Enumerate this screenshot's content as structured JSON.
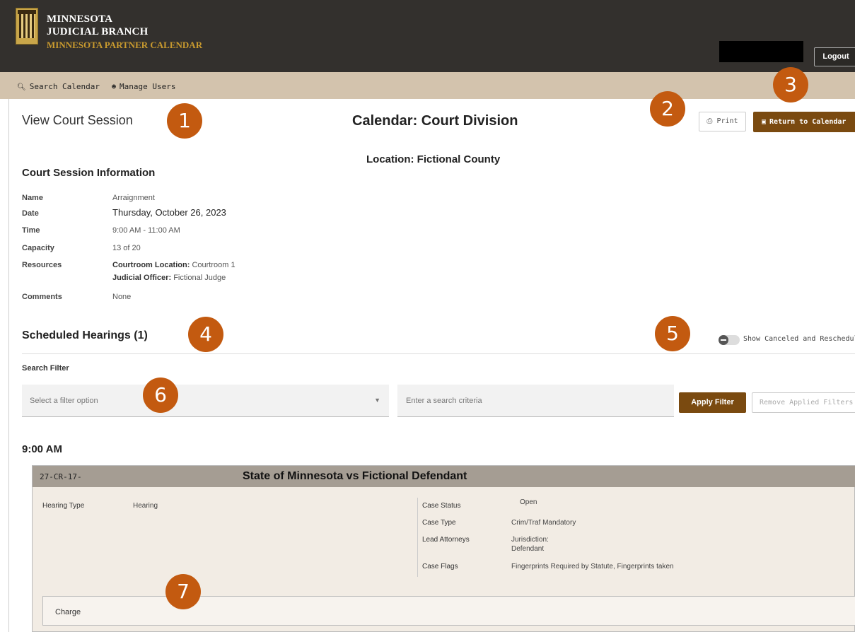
{
  "header": {
    "brand_line1": "MINNESOTA",
    "brand_line2": "JUDICIAL BRANCH",
    "brand_line3": "MINNESOTA PARTNER CALENDAR",
    "logout_label": "Logout"
  },
  "nav": {
    "search_calendar": "Search Calendar",
    "manage_users": "Manage Users"
  },
  "page": {
    "title": "View Court Session",
    "calendar_title": "Calendar: Court Division",
    "location_title": "Location: Fictional County",
    "print_label": "Print",
    "return_label": "Return to Calendar"
  },
  "session_info": {
    "heading": "Court Session Information",
    "name_label": "Name",
    "name_value": "Arraignment",
    "date_label": "Date",
    "date_value": "Thursday, October 26, 2023",
    "time_label": "Time",
    "time_value": "9:00 AM - 11:00 AM",
    "capacity_label": "Capacity",
    "capacity_value": "13 of 20",
    "resources_label": "Resources",
    "courtroom_label": "Courtroom Location:",
    "courtroom_value": "Courtroom 1",
    "judicial_label": "Judicial Officer:",
    "judicial_value": "Fictional Judge",
    "comments_label": "Comments",
    "comments_value": "None"
  },
  "hearings": {
    "heading": "Scheduled Hearings (1)",
    "toggle_label": "Show Canceled and Rescheduled",
    "filter_label": "Search Filter",
    "filter_placeholder": "Select a filter option",
    "search_placeholder": "Enter a search criteria",
    "apply_label": "Apply Filter",
    "remove_label": "Remove Applied Filters",
    "time_group": "9:00 AM"
  },
  "case": {
    "number": "27-CR-17-",
    "title": "State of Minnesota vs Fictional Defendant",
    "hearing_type_label": "Hearing Type",
    "hearing_type_value": "Hearing",
    "case_status_label": "Case Status",
    "case_status_value": "Open",
    "case_type_label": "Case Type",
    "case_type_value": "Crim/Traf Mandatory",
    "lead_attorneys_label": "Lead Attorneys",
    "jurisdiction_label": "Jurisdiction:",
    "defendant_label": "Defendant",
    "case_flags_label": "Case Flags",
    "case_flags_value": "Fingerprints Required by Statute, Fingerprints taken",
    "charge_label": "Charge"
  },
  "badges": [
    "1",
    "2",
    "3",
    "4",
    "5",
    "6",
    "7"
  ],
  "colors": {
    "header_bg": "#33302d",
    "nav_bg": "#d3c3ad",
    "accent_brown": "#7a4a10",
    "badge_orange": "#c35a10",
    "brand_gold": "#c99a2e",
    "card_head": "#a59d93"
  }
}
